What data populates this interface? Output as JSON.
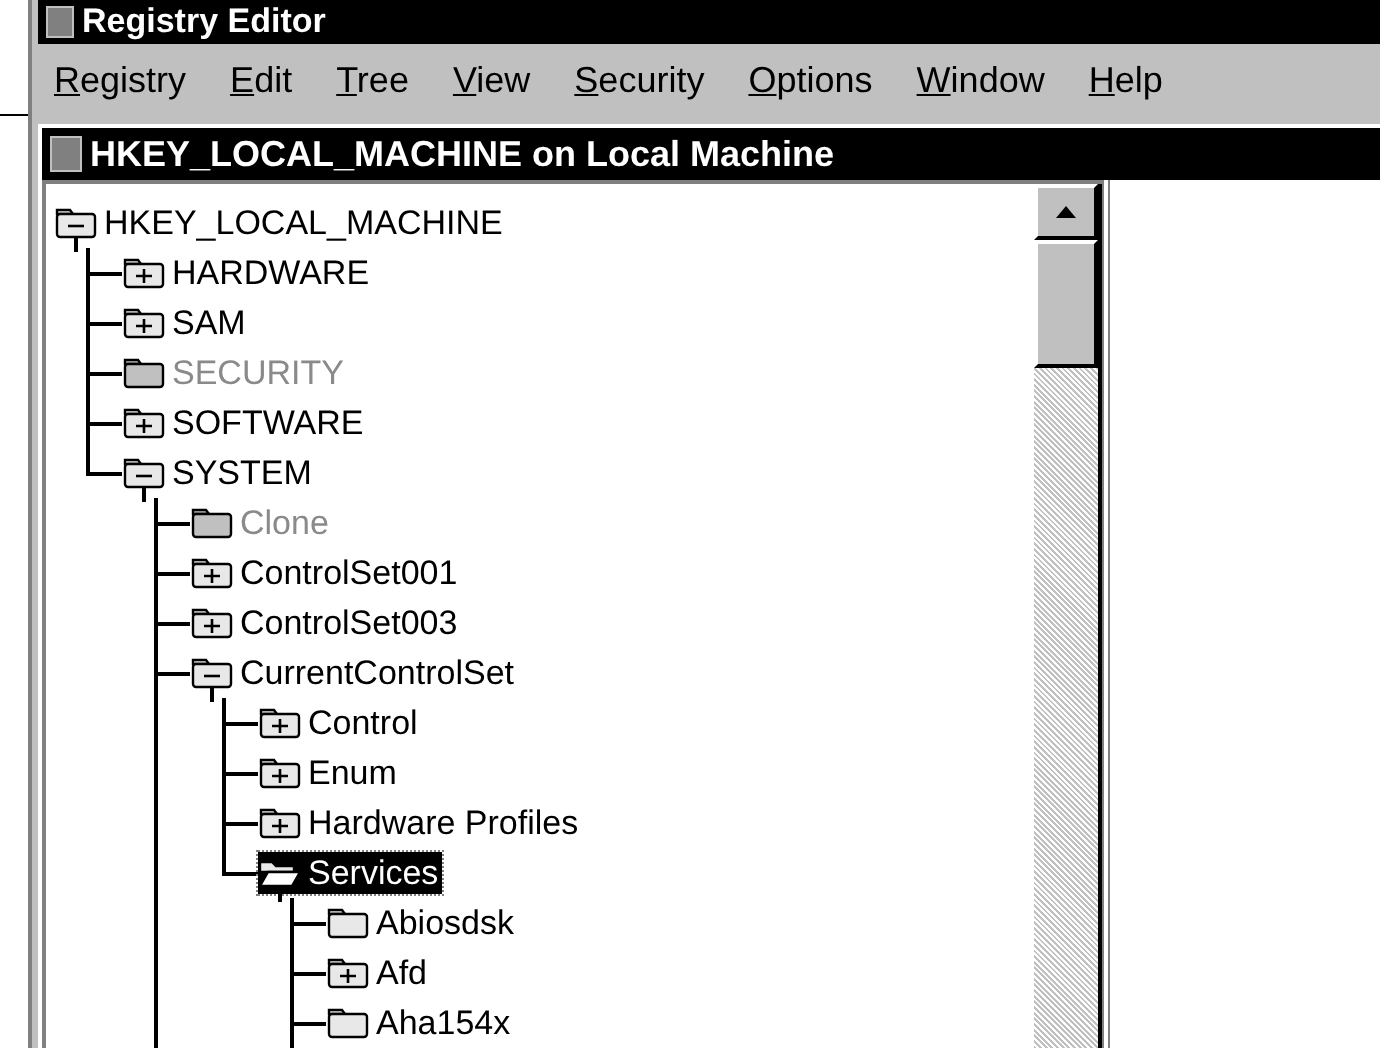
{
  "window": {
    "title": "Registry Editor"
  },
  "menu": [
    {
      "label": "Registry"
    },
    {
      "label": "Edit"
    },
    {
      "label": "Tree"
    },
    {
      "label": "View"
    },
    {
      "label": "Security"
    },
    {
      "label": "Options"
    },
    {
      "label": "Window"
    },
    {
      "label": "Help"
    }
  ],
  "child_window": {
    "title": "HKEY_LOCAL_MACHINE on Local Machine"
  },
  "tree": [
    {
      "label": "HKEY_LOCAL_MACHINE",
      "kind": "expanded",
      "disabled": false,
      "selected": false,
      "more_children": false,
      "children": [
        {
          "label": "HARDWARE",
          "kind": "collapsed",
          "disabled": false,
          "selected": false
        },
        {
          "label": "SAM",
          "kind": "collapsed",
          "disabled": false,
          "selected": false
        },
        {
          "label": "SECURITY",
          "kind": "leaf",
          "disabled": true,
          "selected": false
        },
        {
          "label": "SOFTWARE",
          "kind": "collapsed",
          "disabled": false,
          "selected": false
        },
        {
          "label": "SYSTEM",
          "kind": "expanded",
          "disabled": false,
          "selected": false,
          "more_children": true,
          "children": [
            {
              "label": "Clone",
              "kind": "leaf",
              "disabled": true,
              "selected": false
            },
            {
              "label": "ControlSet001",
              "kind": "collapsed",
              "disabled": false,
              "selected": false
            },
            {
              "label": "ControlSet003",
              "kind": "collapsed",
              "disabled": false,
              "selected": false
            },
            {
              "label": "CurrentControlSet",
              "kind": "expanded",
              "disabled": false,
              "selected": false,
              "more_children": false,
              "children": [
                {
                  "label": "Control",
                  "kind": "collapsed",
                  "disabled": false,
                  "selected": false
                },
                {
                  "label": "Enum",
                  "kind": "collapsed",
                  "disabled": false,
                  "selected": false
                },
                {
                  "label": "Hardware Profiles",
                  "kind": "collapsed",
                  "disabled": false,
                  "selected": false
                },
                {
                  "label": "Services",
                  "kind": "open",
                  "disabled": false,
                  "selected": true,
                  "more_children": true,
                  "children": [
                    {
                      "label": "Abiosdsk",
                      "kind": "leaf",
                      "disabled": false,
                      "selected": false
                    },
                    {
                      "label": "Afd",
                      "kind": "collapsed",
                      "disabled": false,
                      "selected": false
                    },
                    {
                      "label": "Aha154x",
                      "kind": "leaf",
                      "disabled": false,
                      "selected": false
                    }
                  ]
                }
              ]
            }
          ]
        }
      ]
    }
  ]
}
